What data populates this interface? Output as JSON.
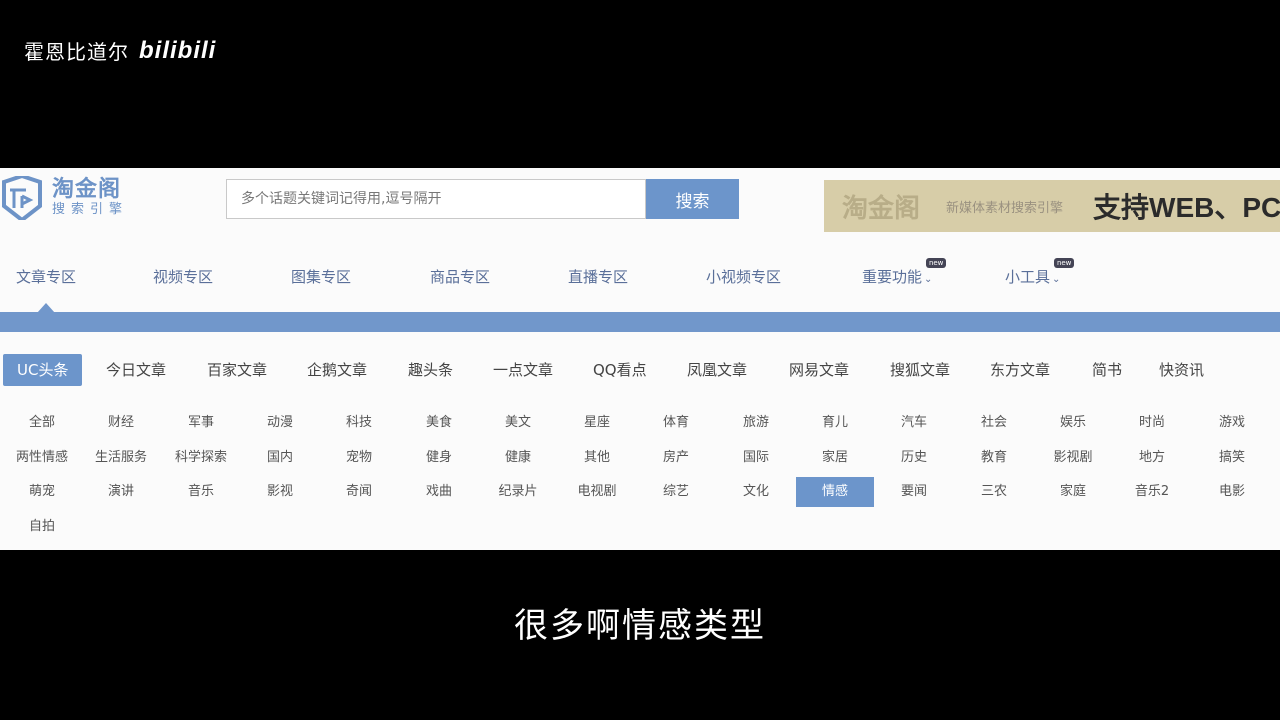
{
  "watermark": {
    "author": "霍恩比道尔",
    "logo": "bilibili"
  },
  "brand": {
    "name": "淘金阁",
    "tagline": "搜索引擎"
  },
  "search": {
    "placeholder": "多个话题关键词记得用,逗号隔开",
    "button_label": "搜索"
  },
  "banner": {
    "logo": "淘金阁",
    "slogan": "新媒体素材搜索引擎",
    "support": "支持WEB、PC"
  },
  "nav": {
    "items": [
      {
        "label": "文章专区"
      },
      {
        "label": "视频专区"
      },
      {
        "label": "图集专区"
      },
      {
        "label": "商品专区"
      },
      {
        "label": "直播专区"
      },
      {
        "label": "小视频专区"
      },
      {
        "label": "重要功能",
        "badge": "new",
        "caret": "⌄"
      },
      {
        "label": "小工具",
        "badge": "new",
        "caret": "⌄"
      }
    ],
    "active_index": 0
  },
  "sources": {
    "items": [
      "UC头条",
      "今日文章",
      "百家文章",
      "企鹅文章",
      "趣头条",
      "一点文章",
      "QQ看点",
      "凤凰文章",
      "网易文章",
      "搜狐文章",
      "东方文章",
      "简书",
      "快资讯"
    ],
    "active_index": 0
  },
  "categories": {
    "items": [
      "全部",
      "财经",
      "军事",
      "动漫",
      "科技",
      "美食",
      "美文",
      "星座",
      "体育",
      "旅游",
      "育儿",
      "汽车",
      "社会",
      "娱乐",
      "时尚",
      "游戏",
      "两性情感",
      "生活服务",
      "科学探索",
      "国内",
      "宠物",
      "健身",
      "健康",
      "其他",
      "房产",
      "国际",
      "家居",
      "历史",
      "教育",
      "影视剧",
      "地方",
      "搞笑",
      "萌宠",
      "演讲",
      "音乐",
      "影视",
      "奇闻",
      "戏曲",
      "纪录片",
      "电视剧",
      "综艺",
      "文化",
      "情感",
      "要闻",
      "三农",
      "家庭",
      "音乐2",
      "电影",
      "自拍"
    ],
    "active_index": 42
  },
  "subtitle": "很多啊情感类型",
  "colors": {
    "accent": "#6c95cb",
    "banner_bg": "#d7cda8"
  }
}
